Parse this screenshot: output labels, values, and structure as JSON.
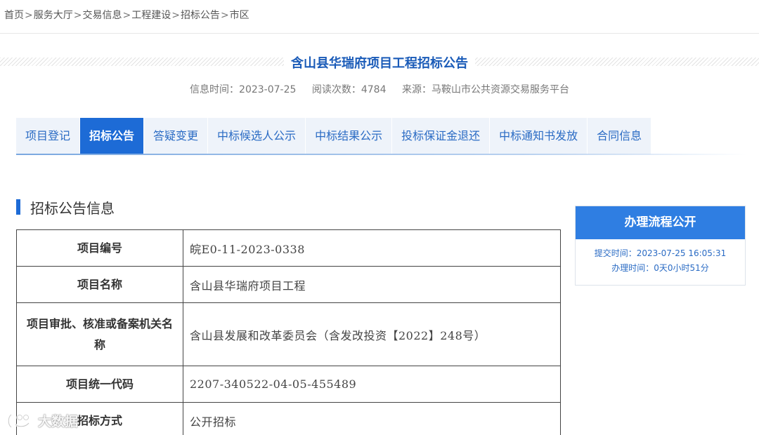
{
  "breadcrumb": {
    "items": [
      "首页",
      "服务大厅",
      "交易信息",
      "工程建设",
      "招标公告",
      "市区"
    ],
    "separator": ">"
  },
  "page": {
    "title": "含山县华瑞府项目工程招标公告",
    "meta": {
      "info_time": "信息时间：2023-07-25",
      "read_count": "阅读次数：4784",
      "source": "来源：马鞍山市公共资源交易服务平台"
    }
  },
  "tabs": {
    "items": [
      "项目登记",
      "招标公告",
      "答疑变更",
      "中标候选人公示",
      "中标结果公示",
      "投标保证金退还",
      "中标通知书发放",
      "合同信息"
    ],
    "active_index": 1
  },
  "section": {
    "title": "招标公告信息"
  },
  "info_table": {
    "rows": [
      {
        "label": "项目编号",
        "value": "皖E0-11-2023-0338"
      },
      {
        "label": "项目名称",
        "value": "含山县华瑞府项目工程"
      },
      {
        "label": "项目审批、核准或备案机关名称",
        "value": "含山县发展和改革委员会（含发改投资【2022】248号）"
      },
      {
        "label": "项目统一代码",
        "value": "2207-340522-04-05-455489"
      },
      {
        "label": "招标方式",
        "value": "公开招标"
      }
    ]
  },
  "side_card": {
    "title": "办理流程公开",
    "submit_time": "提交时间：2023-07-25 16:05:31",
    "process_time": "办理时间：0天0小时51分"
  },
  "watermark": {
    "text": "大数据"
  },
  "colors": {
    "accent": "#1d6bd6",
    "title_blue": "#1a5bb8",
    "tab_bg": "#eef3fa",
    "card_header": "#2f7ee2"
  }
}
